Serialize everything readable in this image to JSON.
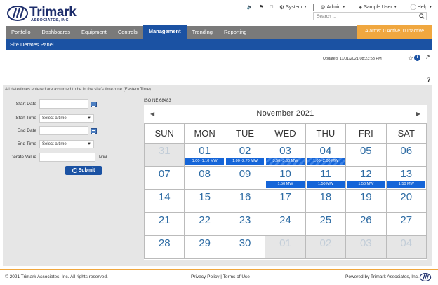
{
  "brand": {
    "name": "Trimark",
    "sub": "ASSOCIATES, INC."
  },
  "topbar": {
    "system": "System",
    "admin": "Admin",
    "user": "Sample User",
    "help": "Help"
  },
  "search": {
    "placeholder": "Search ..."
  },
  "nav": {
    "tabs": [
      "Portfolio",
      "Dashboards",
      "Equipment",
      "Controls",
      "Management",
      "Trending",
      "Reporting"
    ],
    "active_tab": "Management",
    "alarms": "Alarms: 0 Active, 0 Inactive"
  },
  "subnav": {
    "title": "Site Derates Panel"
  },
  "updated": "Updated: 11/01/2021 08:23:53 PM",
  "help_mark": "?",
  "tz_note": "All date/times entered are assumed to be in the site's timezone (Eastern Time)",
  "form": {
    "start_date": "Start Date",
    "start_time": "Start Time",
    "end_date": "End Date",
    "end_time": "End Time",
    "derate_value": "Derate Value",
    "time_placeholder": "Select a time",
    "unit": "MW",
    "submit": "Submit"
  },
  "iso": "ISO NE:68483",
  "calendar": {
    "month": "November 2021",
    "weekdays": [
      "SUN",
      "MON",
      "TUE",
      "WED",
      "THU",
      "FRI",
      "SAT"
    ],
    "weeks": [
      [
        {
          "d": "31",
          "o": true
        },
        {
          "d": "01",
          "e": "1.00~1.10 MW"
        },
        {
          "d": "02",
          "e": "1.00~2.70 MW"
        },
        {
          "d": "03",
          "e": "3.50~3.60 MW",
          "s": true
        },
        {
          "d": "04",
          "e": "1.00~2.00 MW",
          "s": true
        },
        {
          "d": "05"
        },
        {
          "d": "06"
        }
      ],
      [
        {
          "d": "07"
        },
        {
          "d": "08"
        },
        {
          "d": "09"
        },
        {
          "d": "10",
          "e": "1.50 MW"
        },
        {
          "d": "11",
          "e": "1.50 MW"
        },
        {
          "d": "12",
          "e": "1.50 MW"
        },
        {
          "d": "13",
          "e": "1.50 MW"
        }
      ],
      [
        {
          "d": "14"
        },
        {
          "d": "15"
        },
        {
          "d": "16"
        },
        {
          "d": "17"
        },
        {
          "d": "18"
        },
        {
          "d": "19"
        },
        {
          "d": "20"
        }
      ],
      [
        {
          "d": "21"
        },
        {
          "d": "22"
        },
        {
          "d": "23"
        },
        {
          "d": "24"
        },
        {
          "d": "25"
        },
        {
          "d": "26"
        },
        {
          "d": "27"
        }
      ],
      [
        {
          "d": "28"
        },
        {
          "d": "29"
        },
        {
          "d": "30"
        },
        {
          "d": "01",
          "o": true
        },
        {
          "d": "02",
          "o": true
        },
        {
          "d": "03",
          "o": true
        },
        {
          "d": "04",
          "o": true
        }
      ]
    ]
  },
  "footer": {
    "copyright": "© 2021 Trimark Associates, Inc. All rights reserved.",
    "links": "Privacy Policy | Terms of Use",
    "powered": "Powered by Trimark Associates, Inc."
  }
}
